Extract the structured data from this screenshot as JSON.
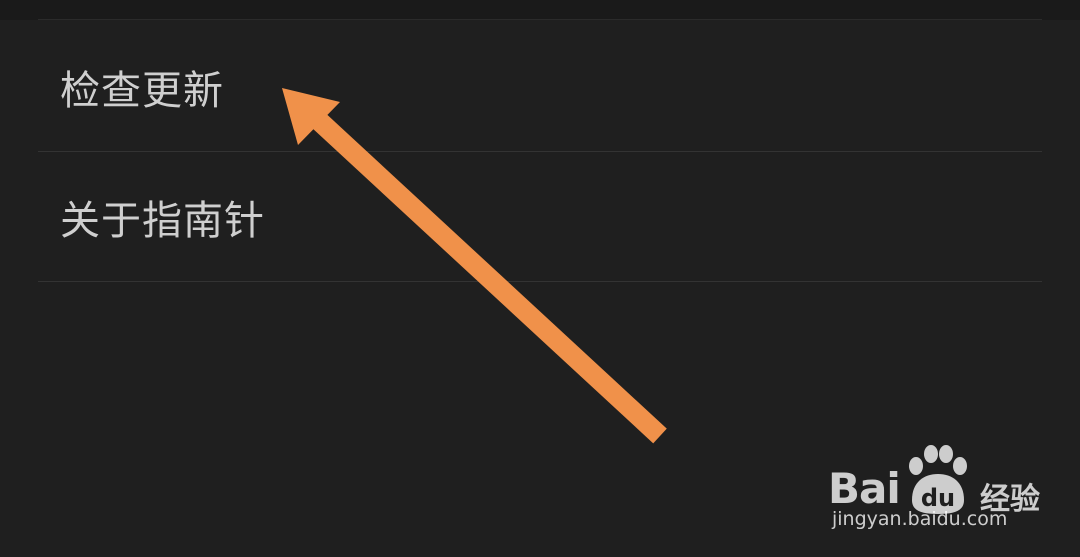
{
  "menu": {
    "items": [
      {
        "label": "检查更新"
      },
      {
        "label": "关于指南针"
      }
    ]
  },
  "annotation": {
    "arrow_color": "#f0914a",
    "arrow_points_to": "检查更新"
  },
  "watermark": {
    "brand": "Bai",
    "paw_text": "du",
    "product": "经验",
    "url": "jingyan.baidu.com"
  },
  "colors": {
    "background": "#1f1f1f",
    "text": "#cfcfcf",
    "divider": "#333333",
    "accent": "#f0914a"
  }
}
